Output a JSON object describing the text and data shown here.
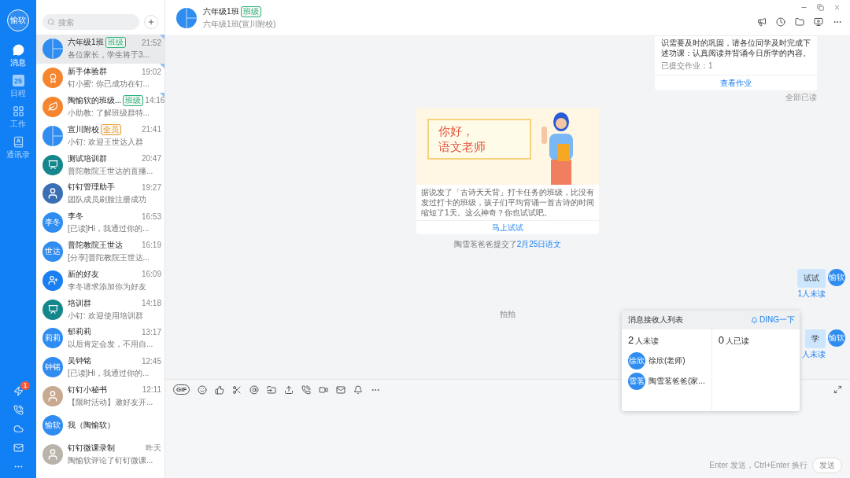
{
  "rail": {
    "avatar": "愉软",
    "nav": [
      {
        "label": "消息",
        "selected": true
      },
      {
        "label": "日程",
        "badge_text": "25",
        "selected": false
      },
      {
        "label": "工作",
        "selected": false
      },
      {
        "label": "通讯录",
        "selected": false
      }
    ],
    "alert_badge": "1"
  },
  "search": {
    "placeholder": "搜索"
  },
  "chats": [
    {
      "name": "六年级1班",
      "tag": {
        "text": "班级",
        "color": "#27b27c"
      },
      "time": "21:52",
      "preview": "各位家长，学生将于3...",
      "avatar": {
        "kind": "split",
        "color": "#2f8cf0"
      },
      "selected": true,
      "pinned": true
    },
    {
      "name": "新手体验群",
      "time": "19:02",
      "preview": "钉小蜜: 你已成功在钉...",
      "avatar": {
        "kind": "emblem",
        "color": "#f5862f"
      },
      "selected": false,
      "pinned": true
    },
    {
      "name": "陶愉软的班级...",
      "tag": {
        "text": "班级",
        "color": "#27b27c"
      },
      "time": "14:16",
      "preview": "小助教: 了解班级群特...",
      "avatar": {
        "kind": "leaf",
        "color": "#f5862f"
      },
      "selected": false,
      "pinned": true
    },
    {
      "name": "宣川附校",
      "tag": {
        "text": "全员",
        "color": "#ee9b2d"
      },
      "time": "21:41",
      "preview": "小钉: 欢迎王世达入群",
      "avatar": {
        "kind": "split",
        "color": "#2f8cf0"
      },
      "selected": false,
      "pinned": false
    },
    {
      "name": "测试培训群",
      "time": "20:47",
      "preview": "普陀教院王世达的直播...",
      "avatar": {
        "kind": "board",
        "color": "#14868c"
      },
      "selected": false,
      "pinned": false
    },
    {
      "name": "钉钉管理助手",
      "time": "19:27",
      "preview": "团队成员刷脸注册成功",
      "avatar": {
        "kind": "photo",
        "color": "#3b6fb5"
      },
      "selected": false,
      "pinned": false
    },
    {
      "name": "李冬",
      "time": "16:53",
      "preview": "[已读]Hi，我通过你的...",
      "avatar": {
        "kind": "text",
        "text": "李冬",
        "color": "#2f8cf0"
      },
      "selected": false,
      "pinned": false
    },
    {
      "name": "普陀教院王世达",
      "time": "16:19",
      "preview": "[分享]普陀教院王世达...",
      "avatar": {
        "kind": "text",
        "text": "世达",
        "color": "#2f8cf0"
      },
      "selected": false,
      "pinned": false
    },
    {
      "name": "新的好友",
      "time": "16:09",
      "preview": "李冬请求添加你为好友",
      "avatar": {
        "kind": "adduser",
        "color": "#1a7ff0"
      },
      "selected": false,
      "pinned": false
    },
    {
      "name": "培训群",
      "time": "14:18",
      "preview": "小钉: 欢迎使用培训群",
      "avatar": {
        "kind": "board",
        "color": "#14868c"
      },
      "selected": false,
      "pinned": false
    },
    {
      "name": "郁莉莉",
      "time": "13:17",
      "preview": "以后肯定会发，不用自...",
      "avatar": {
        "kind": "text",
        "text": "莉莉",
        "color": "#2f8cf0"
      },
      "selected": false,
      "pinned": false
    },
    {
      "name": "吴钟铭",
      "time": "12:45",
      "preview": "[已读]Hi，我通过你的...",
      "avatar": {
        "kind": "text",
        "text": "钟铭",
        "color": "#2f8cf0"
      },
      "selected": false,
      "pinned": false
    },
    {
      "name": "钉钉小秘书",
      "time": "12:11",
      "preview": "【限时活动】邀好友开...",
      "avatar": {
        "kind": "photo",
        "color": "#c9a98f"
      },
      "selected": false,
      "pinned": false
    },
    {
      "name": "我（陶愉软）",
      "avatar": {
        "kind": "text",
        "text": "愉软",
        "color": "#2f8cf0"
      },
      "selected": false,
      "pinned": false
    },
    {
      "name": "钉钉微课录制",
      "time": "昨天",
      "preview": "陶愉软评论了钉钉微课...",
      "avatar": {
        "kind": "photo",
        "color": "#b9b3aa"
      },
      "selected": false,
      "pinned": false
    }
  ],
  "header": {
    "title": "六年级1班",
    "tag": "班级",
    "subtitle": "六年级1班(宣川附校)"
  },
  "homework": {
    "lines": [
      "识需要及时的巩固，请各位同学及时完成下",
      "述功课：认真阅读并背诵今日所学的内容。"
    ],
    "submitted": "已提交作业：1",
    "action": "查看作业",
    "read_status": "全部已读"
  },
  "promo": {
    "banner_lines": [
      "你好，",
      "语文老师"
    ],
    "text": "据说发了「古诗天天背」打卡任务的班级，比没有发过打卡的班级，孩子们平均背诵一首古诗的时间缩短了1天。这么神奇？你也试试吧。",
    "action": "马上试试"
  },
  "system_message": {
    "text": "陶雪茗爸爸提交了",
    "link": "2月25日语文"
  },
  "pat": "拍拍",
  "my_messages": [
    {
      "text": "试试",
      "receipt": "1人未读",
      "avatar": "愉软"
    },
    {
      "text": "学",
      "receipt": "人未读",
      "avatar": "愉软"
    }
  ],
  "gif_label": "GIF",
  "input_hint": "Enter 发送，Ctrl+Enter 换行",
  "send": {
    "label": "发送",
    "disabled": true
  },
  "receivers": {
    "title": "消息接收人列表",
    "ding": "DING一下",
    "unread_count": "2",
    "unread_label": "人未读",
    "read_count": "0",
    "read_label": "人已读",
    "unread": [
      {
        "avatar": "徐欣",
        "name": "徐欣(老师)"
      },
      {
        "avatar": "雪茗",
        "name": "陶雪茗爸爸(家..."
      }
    ]
  }
}
